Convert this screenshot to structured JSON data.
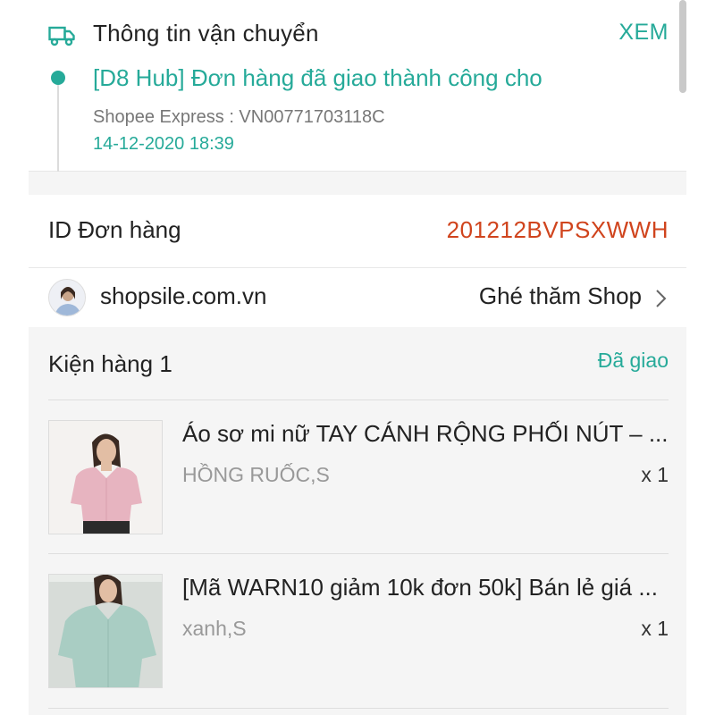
{
  "shipping": {
    "icon": "truck-icon",
    "title": "Thông tin vận chuyển",
    "view_label": "XEM",
    "status": "[D8 Hub] Đơn hàng đã giao thành công cho",
    "carrier": "Shopee Express :  VN00771703118C",
    "datetime": "14-12-2020 18:39"
  },
  "order": {
    "id_label": "ID Đơn hàng",
    "id_value": "201212BVPSXWWH"
  },
  "shop": {
    "name": "shopsile.com.vn",
    "visit_label": "Ghé thăm Shop"
  },
  "package": {
    "title": "Kiện hàng 1",
    "status": "Đã giao",
    "items": [
      {
        "name": "Áo sơ mi nữ TAY CÁNH RỘNG PHỐI NÚT – ...",
        "variation": "HỒNG RUỐC,S",
        "quantity": "x 1"
      },
      {
        "name": "[Mã WARN10 giảm 10k đơn 50k] Bán lẻ giá ...",
        "variation": "xanh,S",
        "quantity": "x 1"
      }
    ]
  },
  "colors": {
    "accent": "#26aa99",
    "order_id": "#d0441d",
    "background_gray": "#f5f5f5"
  }
}
